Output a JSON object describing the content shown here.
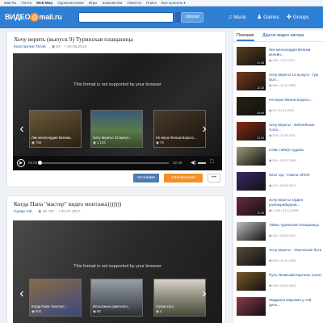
{
  "topnav": {
    "items": [
      "Mail.Ru",
      "Почта",
      "Мой Мир",
      "Одноклассники",
      "Игры",
      "Знакомства",
      "Новости",
      "Поиск",
      "Все проекты ▾"
    ],
    "strong_index": 2
  },
  "header": {
    "logo_text": "ВИДЕО",
    "logo_domain": "mail.ru",
    "search_placeholder": "",
    "upload_label": "Upload",
    "nav": [
      {
        "icon": "♫",
        "label": "Music"
      },
      {
        "icon": "♟",
        "label": "Games"
      },
      {
        "icon": "✤",
        "label": "Groups"
      }
    ]
  },
  "videos": [
    {
      "title": "Хочу верить (выпуск 9) Туринская плащаница",
      "author": "Константин Титов",
      "views": "◉ 63",
      "date": "▪ 20.05.2015",
      "not_supported": "This format is not supported by your browser",
      "time_current": "00:00",
      "time_total": "22:40",
      "suggestions": [
        {
          "label": "Лик мелосердия Велики...",
          "views": "◉ 768"
        },
        {
          "label": "Хочу верить! 13 выпус...",
          "views": "◉ 1 103"
        },
        {
          "label": "Не верю Фильм Борисс...",
          "views": "◉ 79"
        }
      ]
    },
    {
      "title": "Когда Папа \"мастер\" видео монтажа)))))))",
      "author": "Супер той",
      "views": "◉ 46 797",
      "date": "▪ 05.07.2017",
      "not_supported": "This format is not supported by your browser",
      "suggestions": [
        {
          "label": "Когда Папа \"мастер\"...",
          "views": "◉ 600"
        },
        {
          "label": "Испытание ракетного...",
          "views": "◉ 88"
        },
        {
          "label": "Супер хэто",
          "views": "◉ 6"
        }
      ]
    }
  ],
  "share": {
    "vk": "VKontakte",
    "ok": "Odnoklassniki",
    "more": "•••"
  },
  "sidebar": {
    "tabs": [
      "Похожие",
      "Другое видео автора"
    ],
    "items": [
      {
        "title": "Лик мелосердия Велики келейн...",
        "meta": "◉ 768 • 11.07.2017",
        "dur": "01:08",
        "color": "#5a4020"
      },
      {
        "title": "Хочу верить! 13 выпуск - Где был...",
        "meta": "◉ 680 • 14.10.2009",
        "dur": "22:35",
        "color": "#7a3c1c"
      },
      {
        "title": "Не верю Фильм Борисо...",
        "meta": "◉ 32 • 21.01.2019",
        "dur": "44:44",
        "color": "#2a2015"
      },
      {
        "title": "Хочу верить! - Библейские Соло...",
        "meta": "◉ 243 • 31.05.2011",
        "dur": "22:04",
        "color": "#8a2a14"
      },
      {
        "title": "Семь тайн(е судьбы",
        "meta": "◉ 291 • 06.02.2009",
        "dur": "",
        "color": "#a09a78"
      },
      {
        "title": "2012 год - Смена ЭПОХ",
        "meta": "◉ 174 • 09.04.2013",
        "dur": "",
        "color": "#3a2a6a"
      },
      {
        "title": "Хочу верить! Орден розенкрейцеров...",
        "meta": "◉ 1 209 • 24.12.2009",
        "dur": "22:29",
        "color": "#6a2a3a"
      },
      {
        "title": "Тайна туринской плащаницы",
        "meta": "◉ 110 • 15.08.2012",
        "dur": "",
        "color": "#c0c0c0"
      },
      {
        "title": "Хочу верить! - Языческие боги",
        "meta": "◉ 909 • 16.10.2009",
        "dur": "",
        "color": "#5a4a3a"
      },
      {
        "title": "Руль Яновский Картины (олат)",
        "meta": "◉ 108 • 25.04.2015",
        "dur": "",
        "color": "#7a5a2a"
      },
      {
        "title": "Людмила Ивушкин у сей день...",
        "meta": "",
        "dur": "",
        "color": "#8a3a4a"
      }
    ]
  }
}
